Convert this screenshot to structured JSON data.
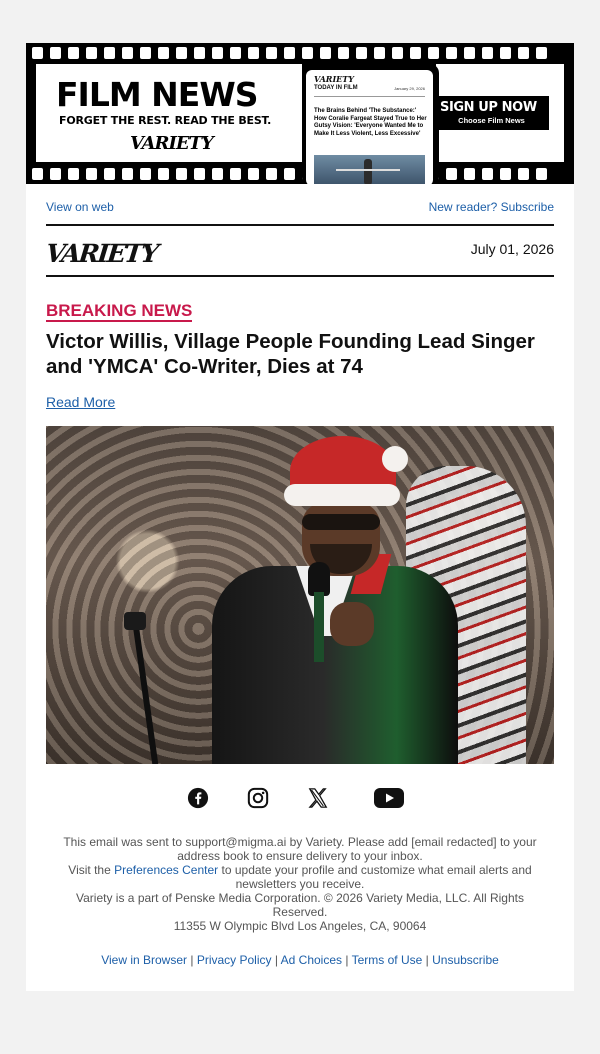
{
  "banner": {
    "title": "FILM NEWS",
    "tagline": "FORGET THE REST. READ THE BEST.",
    "logo": "VARIETY",
    "phone_logo": "VARIETY",
    "phone_section": "TODAY IN FILM",
    "phone_date": "January 29, 2026",
    "phone_headline": "The Brains Behind 'The Substance:' How Coralie Fargeat Stayed True to Her Gutsy Vision: 'Everyone Wanted Me to Make It Less Violent, Less Excessive'",
    "signup_label": "SIGN UP NOW",
    "signup_sub": "Choose Film News"
  },
  "top_links": {
    "view_web": "View on web",
    "subscribe": "New reader? Subscribe"
  },
  "masthead": {
    "logo": "VARIETY",
    "date": "July 01, 2026"
  },
  "article": {
    "kicker": "BREAKING NEWS",
    "headline": "Victor Willis, Village People Founding Lead Singer and 'YMCA' Co-Writer, Dies at 74",
    "read_more": "Read More"
  },
  "social": [
    "facebook-icon",
    "instagram-icon",
    "x-icon",
    "youtube-icon"
  ],
  "footer": {
    "line1": "This email was sent to support@migma.ai by Variety. Please add [email redacted] to your address book to ensure delivery to your inbox.",
    "line2_pre": "Visit the ",
    "line2_link": "Preferences Center",
    "line2_post": " to update your profile and customize what email alerts and newsletters you receive.",
    "line3": "Variety is a part of Penske Media Corporation. © 2026 Variety Media, LLC. All Rights Reserved.",
    "line4": "11355 W Olympic Blvd Los Angeles, CA, 90064"
  },
  "legal_links": {
    "view_browser": "View in Browser",
    "privacy": "Privacy Policy",
    "ad_choices": "Ad Choices",
    "terms": "Terms of Use",
    "unsubscribe": "Unsubscribe",
    "separator": "|"
  },
  "colors": {
    "accent": "#c8194b",
    "link": "#1d5fa8",
    "background": "#f2f2f2"
  }
}
